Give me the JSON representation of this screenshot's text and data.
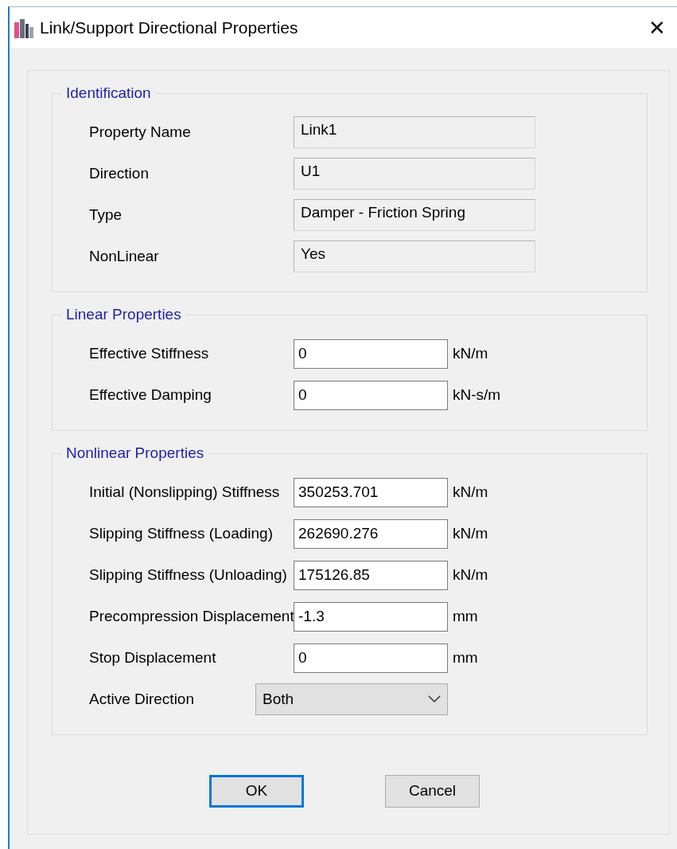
{
  "window": {
    "title": "Link/Support Directional Properties",
    "close": "✕"
  },
  "identification": {
    "title": "Identification",
    "fields": [
      {
        "label": "Property Name",
        "value": "Link1"
      },
      {
        "label": "Direction",
        "value": "U1"
      },
      {
        "label": "Type",
        "value": "Damper - Friction Spring"
      },
      {
        "label": "NonLinear",
        "value": "Yes"
      }
    ]
  },
  "linear_properties": {
    "title": "Linear Properties",
    "rows": [
      {
        "kind": "input",
        "label": "Effective Stiffness",
        "value": "0",
        "unit": "kN/m"
      },
      {
        "kind": "input",
        "label": "Effective Damping",
        "value": "0",
        "unit": "kN-s/m"
      }
    ]
  },
  "nonlinear_properties": {
    "title": "Nonlinear Properties",
    "rows": [
      {
        "kind": "input",
        "label": "Initial (Nonslipping) Stiffness",
        "value": "350253.701",
        "unit": "kN/m"
      },
      {
        "kind": "input",
        "label": "Slipping Stiffness (Loading)",
        "value": "262690.276",
        "unit": "kN/m"
      },
      {
        "kind": "input",
        "label": "Slipping Stiffness (Unloading)",
        "value": "175126.85",
        "unit": "kN/m"
      },
      {
        "kind": "input",
        "label": "Precompression Displacement",
        "value": "-1.3",
        "unit": "mm"
      },
      {
        "kind": "input",
        "label": "Stop Displacement",
        "value": "0",
        "unit": "mm"
      },
      {
        "kind": "dropdown",
        "label": "Active Direction",
        "value": "Both"
      }
    ]
  },
  "buttons": [
    {
      "label": "OK",
      "focused": true
    },
    {
      "label": "Cancel",
      "focused": false
    }
  ]
}
